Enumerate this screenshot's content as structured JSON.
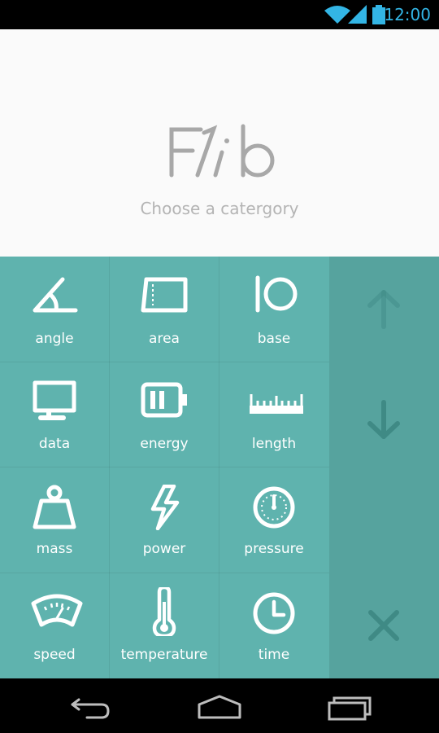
{
  "status": {
    "time": "12:00"
  },
  "header": {
    "logo_text": "F1ib",
    "subtitle": "Choose a catergory"
  },
  "categories": [
    {
      "label": "angle",
      "icon": "angle-icon"
    },
    {
      "label": "area",
      "icon": "area-icon"
    },
    {
      "label": "base",
      "icon": "base-icon"
    },
    {
      "label": "data",
      "icon": "monitor-icon"
    },
    {
      "label": "energy",
      "icon": "battery-icon"
    },
    {
      "label": "length",
      "icon": "ruler-icon"
    },
    {
      "label": "mass",
      "icon": "weight-icon"
    },
    {
      "label": "power",
      "icon": "lightning-icon"
    },
    {
      "label": "pressure",
      "icon": "gauge-icon"
    },
    {
      "label": "speed",
      "icon": "speedometer-icon"
    },
    {
      "label": "temperature",
      "icon": "thermometer-icon"
    },
    {
      "label": "time",
      "icon": "clock-icon"
    }
  ],
  "side": {
    "up_icon": "arrow-up-icon",
    "down_icon": "arrow-down-icon",
    "close_icon": "close-icon"
  },
  "colors": {
    "grid": "#5fb3ae",
    "side": "#56a39e",
    "side_icon": "#3f8a85",
    "header_bg": "#fafafa",
    "status_accent": "#33b5e5"
  }
}
